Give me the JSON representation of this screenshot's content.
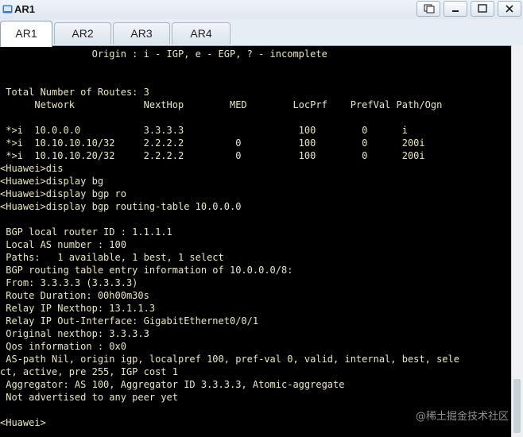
{
  "window": {
    "title": "AR1"
  },
  "tabs": [
    {
      "label": "AR1",
      "active": true
    },
    {
      "label": "AR2",
      "active": false
    },
    {
      "label": "AR3",
      "active": false
    },
    {
      "label": "AR4",
      "active": false
    }
  ],
  "terminal": {
    "lines": [
      "                Origin : i - IGP, e - EGP, ? - incomplete",
      "",
      "",
      " Total Number of Routes: 3",
      "      Network            NextHop        MED        LocPrf    PrefVal Path/Ogn",
      "",
      " *>i  10.0.0.0           3.3.3.3                    100        0      i",
      " *>i  10.10.10.10/32     2.2.2.2         0          100        0      200i",
      " *>i  10.10.10.20/32     2.2.2.2         0          100        0      200i",
      "<Huawei>dis",
      "<Huawei>display bg",
      "<Huawei>display bgp ro",
      "<Huawei>display bgp routing-table 10.0.0.0",
      "",
      " BGP local router ID : 1.1.1.1",
      " Local AS number : 100",
      " Paths:   1 available, 1 best, 1 select",
      " BGP routing table entry information of 10.0.0.0/8:",
      " From: 3.3.3.3 (3.3.3.3)",
      " Route Duration: 00h00m30s",
      " Relay IP Nexthop: 13.1.1.3",
      " Relay IP Out-Interface: GigabitEthernet0/0/1",
      " Original nexthop: 3.3.3.3",
      " Qos information : 0x0",
      " AS-path Nil, origin igp, localpref 100, pref-val 0, valid, internal, best, sele",
      "ct, active, pre 255, IGP cost 1",
      " Aggregator: AS 100, Aggregator ID 3.3.3.3, Atomic-aggregate",
      " Not advertised to any peer yet",
      "",
      "<Huawei>"
    ]
  },
  "watermark": "@稀土掘金技术社区"
}
